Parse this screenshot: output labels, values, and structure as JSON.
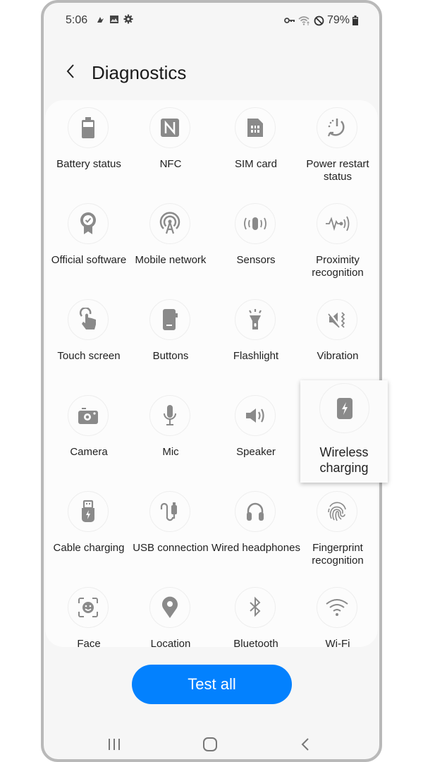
{
  "status_bar": {
    "time": "5:06",
    "left_icons": [
      "notification-icon",
      "image-icon",
      "gear-icon"
    ],
    "right_icons": [
      "vpn-key-icon",
      "wifi-data-icon",
      "do-not-disturb-icon"
    ],
    "battery": "79%"
  },
  "header": {
    "back_icon": "chevron-left-icon",
    "title": "Diagnostics"
  },
  "tests": [
    {
      "label": "Battery status",
      "icon": "battery-icon"
    },
    {
      "label": "NFC",
      "icon": "nfc-icon"
    },
    {
      "label": "SIM card",
      "icon": "sim-card-icon"
    },
    {
      "label": "Power restart status",
      "icon": "power-restart-icon"
    },
    {
      "label": "Official software",
      "icon": "badge-check-icon"
    },
    {
      "label": "Mobile network",
      "icon": "antenna-icon"
    },
    {
      "label": "Sensors",
      "icon": "sensors-icon"
    },
    {
      "label": "Proximity recognition",
      "icon": "proximity-icon"
    },
    {
      "label": "Touch screen",
      "icon": "touch-icon"
    },
    {
      "label": "Buttons",
      "icon": "phone-buttons-icon"
    },
    {
      "label": "Flashlight",
      "icon": "flashlight-icon"
    },
    {
      "label": "Vibration",
      "icon": "vibration-icon"
    },
    {
      "label": "Camera",
      "icon": "camera-icon"
    },
    {
      "label": "Mic",
      "icon": "mic-icon"
    },
    {
      "label": "Speaker",
      "icon": "speaker-icon"
    },
    {
      "label": "Wireless charging",
      "icon": "wireless-charging-icon"
    },
    {
      "label": "Cable charging",
      "icon": "cable-charging-icon"
    },
    {
      "label": "USB connection",
      "icon": "usb-connection-icon"
    },
    {
      "label": "Wired headphones",
      "icon": "headphones-icon"
    },
    {
      "label": "Fingerprint recognition",
      "icon": "fingerprint-icon"
    },
    {
      "label": "Face",
      "icon": "face-icon"
    },
    {
      "label": "Location",
      "icon": "location-pin-icon"
    },
    {
      "label": "Bluetooth",
      "icon": "bluetooth-icon"
    },
    {
      "label": "Wi-Fi",
      "icon": "wifi-icon"
    }
  ],
  "highlighted": {
    "label": "Wireless charging",
    "icon": "wireless-charging-icon"
  },
  "test_all_button": {
    "label": "Test all",
    "color": "#0381fe"
  },
  "nav_bar": {
    "recents": "recents-icon",
    "home": "home-icon",
    "back": "back-icon"
  }
}
